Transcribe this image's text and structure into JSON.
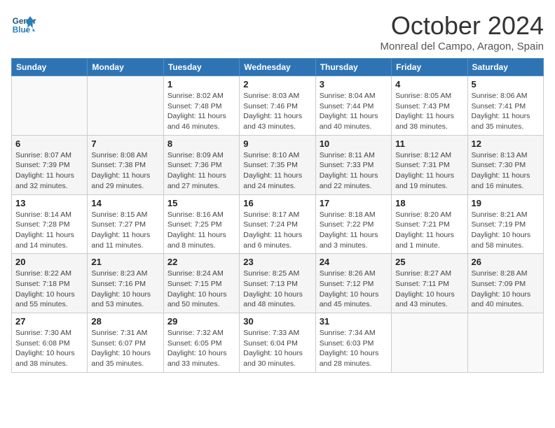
{
  "header": {
    "logo_line1": "General",
    "logo_line2": "Blue",
    "month": "October 2024",
    "location": "Monreal del Campo, Aragon, Spain"
  },
  "days_of_week": [
    "Sunday",
    "Monday",
    "Tuesday",
    "Wednesday",
    "Thursday",
    "Friday",
    "Saturday"
  ],
  "weeks": [
    [
      {
        "day": "",
        "info": ""
      },
      {
        "day": "",
        "info": ""
      },
      {
        "day": "1",
        "info": "Sunrise: 8:02 AM\nSunset: 7:48 PM\nDaylight: 11 hours and 46 minutes."
      },
      {
        "day": "2",
        "info": "Sunrise: 8:03 AM\nSunset: 7:46 PM\nDaylight: 11 hours and 43 minutes."
      },
      {
        "day": "3",
        "info": "Sunrise: 8:04 AM\nSunset: 7:44 PM\nDaylight: 11 hours and 40 minutes."
      },
      {
        "day": "4",
        "info": "Sunrise: 8:05 AM\nSunset: 7:43 PM\nDaylight: 11 hours and 38 minutes."
      },
      {
        "day": "5",
        "info": "Sunrise: 8:06 AM\nSunset: 7:41 PM\nDaylight: 11 hours and 35 minutes."
      }
    ],
    [
      {
        "day": "6",
        "info": "Sunrise: 8:07 AM\nSunset: 7:39 PM\nDaylight: 11 hours and 32 minutes."
      },
      {
        "day": "7",
        "info": "Sunrise: 8:08 AM\nSunset: 7:38 PM\nDaylight: 11 hours and 29 minutes."
      },
      {
        "day": "8",
        "info": "Sunrise: 8:09 AM\nSunset: 7:36 PM\nDaylight: 11 hours and 27 minutes."
      },
      {
        "day": "9",
        "info": "Sunrise: 8:10 AM\nSunset: 7:35 PM\nDaylight: 11 hours and 24 minutes."
      },
      {
        "day": "10",
        "info": "Sunrise: 8:11 AM\nSunset: 7:33 PM\nDaylight: 11 hours and 22 minutes."
      },
      {
        "day": "11",
        "info": "Sunrise: 8:12 AM\nSunset: 7:31 PM\nDaylight: 11 hours and 19 minutes."
      },
      {
        "day": "12",
        "info": "Sunrise: 8:13 AM\nSunset: 7:30 PM\nDaylight: 11 hours and 16 minutes."
      }
    ],
    [
      {
        "day": "13",
        "info": "Sunrise: 8:14 AM\nSunset: 7:28 PM\nDaylight: 11 hours and 14 minutes."
      },
      {
        "day": "14",
        "info": "Sunrise: 8:15 AM\nSunset: 7:27 PM\nDaylight: 11 hours and 11 minutes."
      },
      {
        "day": "15",
        "info": "Sunrise: 8:16 AM\nSunset: 7:25 PM\nDaylight: 11 hours and 8 minutes."
      },
      {
        "day": "16",
        "info": "Sunrise: 8:17 AM\nSunset: 7:24 PM\nDaylight: 11 hours and 6 minutes."
      },
      {
        "day": "17",
        "info": "Sunrise: 8:18 AM\nSunset: 7:22 PM\nDaylight: 11 hours and 3 minutes."
      },
      {
        "day": "18",
        "info": "Sunrise: 8:20 AM\nSunset: 7:21 PM\nDaylight: 11 hours and 1 minute."
      },
      {
        "day": "19",
        "info": "Sunrise: 8:21 AM\nSunset: 7:19 PM\nDaylight: 10 hours and 58 minutes."
      }
    ],
    [
      {
        "day": "20",
        "info": "Sunrise: 8:22 AM\nSunset: 7:18 PM\nDaylight: 10 hours and 55 minutes."
      },
      {
        "day": "21",
        "info": "Sunrise: 8:23 AM\nSunset: 7:16 PM\nDaylight: 10 hours and 53 minutes."
      },
      {
        "day": "22",
        "info": "Sunrise: 8:24 AM\nSunset: 7:15 PM\nDaylight: 10 hours and 50 minutes."
      },
      {
        "day": "23",
        "info": "Sunrise: 8:25 AM\nSunset: 7:13 PM\nDaylight: 10 hours and 48 minutes."
      },
      {
        "day": "24",
        "info": "Sunrise: 8:26 AM\nSunset: 7:12 PM\nDaylight: 10 hours and 45 minutes."
      },
      {
        "day": "25",
        "info": "Sunrise: 8:27 AM\nSunset: 7:11 PM\nDaylight: 10 hours and 43 minutes."
      },
      {
        "day": "26",
        "info": "Sunrise: 8:28 AM\nSunset: 7:09 PM\nDaylight: 10 hours and 40 minutes."
      }
    ],
    [
      {
        "day": "27",
        "info": "Sunrise: 7:30 AM\nSunset: 6:08 PM\nDaylight: 10 hours and 38 minutes."
      },
      {
        "day": "28",
        "info": "Sunrise: 7:31 AM\nSunset: 6:07 PM\nDaylight: 10 hours and 35 minutes."
      },
      {
        "day": "29",
        "info": "Sunrise: 7:32 AM\nSunset: 6:05 PM\nDaylight: 10 hours and 33 minutes."
      },
      {
        "day": "30",
        "info": "Sunrise: 7:33 AM\nSunset: 6:04 PM\nDaylight: 10 hours and 30 minutes."
      },
      {
        "day": "31",
        "info": "Sunrise: 7:34 AM\nSunset: 6:03 PM\nDaylight: 10 hours and 28 minutes."
      },
      {
        "day": "",
        "info": ""
      },
      {
        "day": "",
        "info": ""
      }
    ]
  ]
}
